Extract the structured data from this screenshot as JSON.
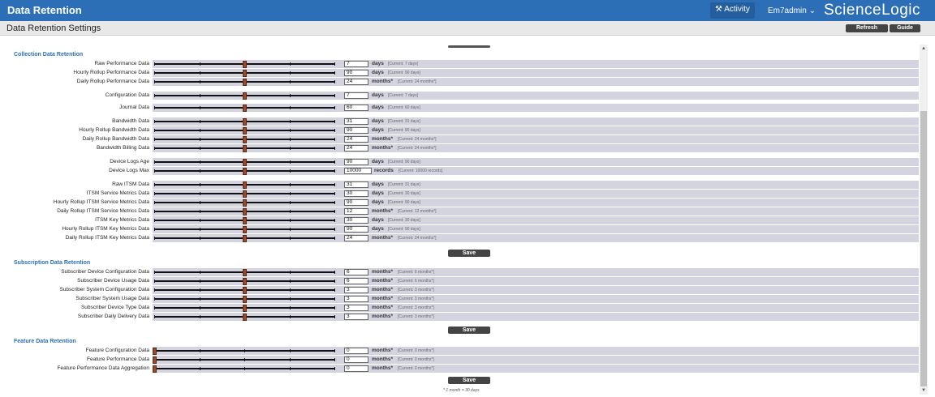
{
  "app": {
    "title": "Data Retention",
    "activity": "Activity",
    "user": "Em7admin ⌄",
    "logo": "ScienceLogic"
  },
  "subbar": {
    "page_title": "Data Retention Settings",
    "refresh": "Refresh",
    "guide": "Guide"
  },
  "sections": [
    {
      "title": "Collection Data Retention",
      "save": "Save",
      "rows": [
        {
          "label": "Raw Performance Data",
          "value": "7",
          "unit": "days",
          "current": "[Current: 7 days]",
          "level": 0.5
        },
        {
          "label": "Hourly Rollup Performance Data",
          "value": "90",
          "unit": "days",
          "current": "[Current: 90 days]",
          "level": 0.5
        },
        {
          "label": "Daily Rollup Performance Data",
          "value": "24",
          "unit": "months*",
          "current": "[Current: 24 months*]",
          "level": 0.5
        },
        {
          "label": "Configuration Data",
          "value": "7",
          "unit": "days",
          "current": "[Current: 7 days]",
          "level": 0.5
        },
        {
          "label": "Journal Data",
          "value": "60",
          "unit": "days",
          "current": "[Current: 60 days]",
          "level": 0.5
        },
        {
          "label": "Bandwidth Data",
          "value": "31",
          "unit": "days",
          "current": "[Current: 31 days]",
          "level": 0.5
        },
        {
          "label": "Hourly Rollup Bandwidth Data",
          "value": "90",
          "unit": "days",
          "current": "[Current: 90 days]",
          "level": 0.5
        },
        {
          "label": "Daily Rollup Bandwidth Data",
          "value": "24",
          "unit": "months*",
          "current": "[Current: 24 months*]",
          "level": 0.5
        },
        {
          "label": "Bandwidth Billing Data",
          "value": "24",
          "unit": "months*",
          "current": "[Current: 24 months*]",
          "level": 0.5
        },
        {
          "label": "Device Logs Age",
          "value": "90",
          "unit": "days",
          "current": "[Current: 90 days]",
          "level": 0.5
        },
        {
          "label": "Device Logs Max",
          "value": "10000",
          "unit": "records",
          "current": "[Current: 10000 records]",
          "level": 0.5
        },
        {
          "label": "Raw ITSM Data",
          "value": "31",
          "unit": "days",
          "current": "[Current: 31 days]",
          "level": 0.5
        },
        {
          "label": "ITSM Service Metrics Data",
          "value": "30",
          "unit": "days",
          "current": "[Current: 30 days]",
          "level": 0.5
        },
        {
          "label": "Hourly Rollup ITSM Service Metrics Data",
          "value": "90",
          "unit": "days",
          "current": "[Current: 90 days]",
          "level": 0.5
        },
        {
          "label": "Daily Rollup ITSM Service Metrics Data",
          "value": "12",
          "unit": "months*",
          "current": "[Current: 12 months*]",
          "level": 0.5
        },
        {
          "label": "ITSM Key Metrics Data",
          "value": "30",
          "unit": "days",
          "current": "[Current: 30 days]",
          "level": 0.5
        },
        {
          "label": "Hourly Rollup ITSM Key Metrics Data",
          "value": "90",
          "unit": "days",
          "current": "[Current: 90 days]",
          "level": 0.5
        },
        {
          "label": "Daily Rollup ITSM Key Metrics Data",
          "value": "24",
          "unit": "months*",
          "current": "[Current: 24 months*]",
          "level": 0.5
        }
      ]
    },
    {
      "title": "Subscription Data Retention",
      "save": "Save",
      "rows": [
        {
          "label": "Subscriber Device Configuration Data",
          "value": "6",
          "unit": "months*",
          "current": "[Current: 6 months*]",
          "level": 0.5
        },
        {
          "label": "Subscriber Device Usage Data",
          "value": "6",
          "unit": "months*",
          "current": "[Current: 6 months*]",
          "level": 0.5
        },
        {
          "label": "Subscriber System Configuration Data",
          "value": "3",
          "unit": "months*",
          "current": "[Current: 3 months*]",
          "level": 0.5
        },
        {
          "label": "Subscriber System Usage Data",
          "value": "3",
          "unit": "months*",
          "current": "[Current: 3 months*]",
          "level": 0.5
        },
        {
          "label": "Subscriber Device Type Data",
          "value": "3",
          "unit": "months*",
          "current": "[Current: 3 months*]",
          "level": 0.5
        },
        {
          "label": "Subscriber Daily Delivery Data",
          "value": "3",
          "unit": "months*",
          "current": "[Current: 3 months*]",
          "level": 0.5
        }
      ]
    },
    {
      "title": "Feature Data Retention",
      "save": "Save",
      "rows": [
        {
          "label": "Feature Configuration Data",
          "value": "0",
          "unit": "months*",
          "current": "[Current: 0 months*]",
          "level": 0
        },
        {
          "label": "Feature Performance Data",
          "value": "0",
          "unit": "months*",
          "current": "[Current: 0 months*]",
          "level": 0
        },
        {
          "label": "Feature Performance Data Aggregation",
          "value": "0",
          "unit": "months*",
          "current": "[Current: 0 months*]",
          "level": 0
        }
      ]
    }
  ],
  "footnote": "* 1 month = 30 days"
}
